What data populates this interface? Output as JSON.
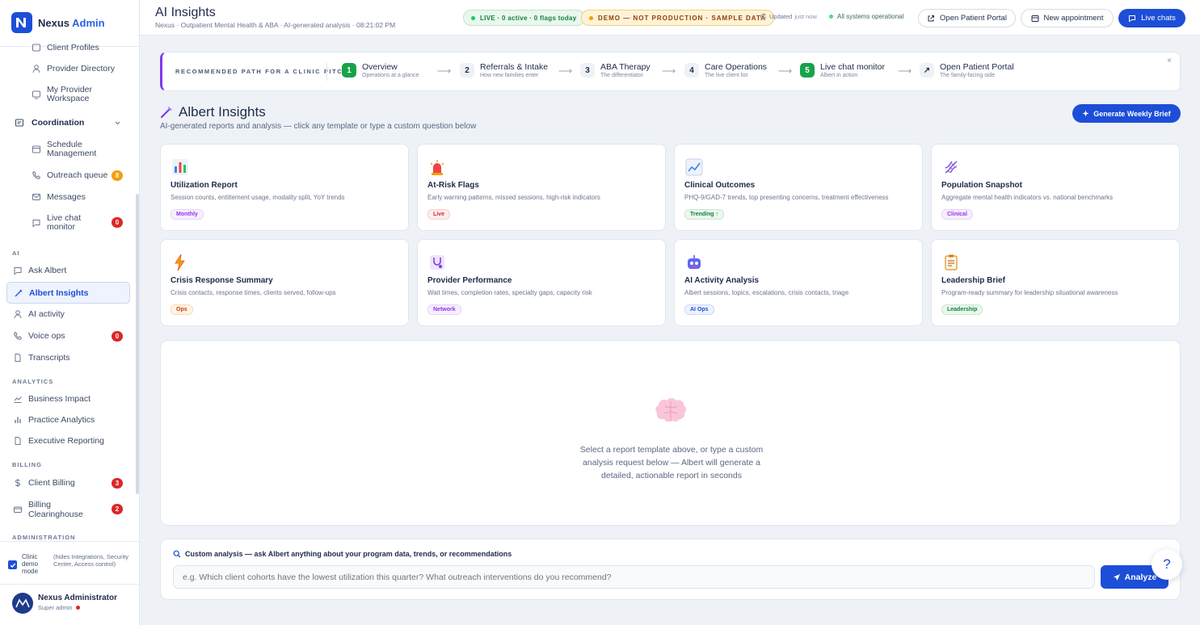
{
  "brand": {
    "name": "Nexus",
    "accent": "Admin"
  },
  "sidebar": {
    "items_top": [
      {
        "label": "Client Profiles",
        "icon": "folder-icon"
      },
      {
        "label": "Provider Directory",
        "icon": "user-icon"
      },
      {
        "label": "My Provider Workspace",
        "icon": "monitor-icon"
      }
    ],
    "coordination": {
      "label": "Coordination",
      "items": [
        {
          "label": "Schedule Management",
          "icon": "calendar-icon"
        },
        {
          "label": "Outreach queue",
          "icon": "phone-icon",
          "badge": "8"
        },
        {
          "label": "Messages",
          "icon": "mail-icon"
        },
        {
          "label": "Live chat monitor",
          "icon": "chat-icon",
          "badge": "0"
        }
      ]
    },
    "sections": {
      "ai": "AI",
      "analytics": "ANALYTICS",
      "billing": "BILLING",
      "admin": "ADMINISTRATION"
    },
    "ai_items": [
      {
        "label": "Ask Albert",
        "icon": "chat-icon"
      },
      {
        "label": "Albert Insights",
        "icon": "wand-icon"
      },
      {
        "label": "AI activity",
        "icon": "user-icon"
      },
      {
        "label": "Voice ops",
        "icon": "phone-icon",
        "badge": "0"
      },
      {
        "label": "Transcripts",
        "icon": "document-icon"
      }
    ],
    "analytics_items": [
      {
        "label": "Business Impact",
        "icon": "trend-icon"
      },
      {
        "label": "Practice Analytics",
        "icon": "bar-chart-icon"
      },
      {
        "label": "Executive Reporting",
        "icon": "document-icon"
      }
    ],
    "billing_items": [
      {
        "label": "Client Billing",
        "icon": "dollar-icon",
        "badge": "3"
      },
      {
        "label": "Billing Clearinghouse",
        "icon": "card-icon",
        "badge": "2"
      }
    ],
    "demo_mode": {
      "label": "Clinic demo mode",
      "note": "(hides Integrations, Security Center, Access control)"
    },
    "user": {
      "name": "Nexus Administrator",
      "role": "Super admin"
    }
  },
  "header": {
    "title": "AI Insights",
    "subtitle": "Nexus · Outpatient Mental Health & ABA · AI-generated analysis · 08:21:02 PM",
    "live_pill": "LIVE · 0 active · 0 flags today",
    "demo_pill": "DEMO — NOT PRODUCTION · SAMPLE DATA",
    "updated_label": "Updated",
    "updated_value": "just now",
    "systems": "All systems operational",
    "btn_portal": "Open Patient Portal",
    "btn_appt": "New appointment",
    "btn_chats": "Live chats"
  },
  "path": {
    "label": "RECOMMENDED PATH FOR A CLINIC PITCH",
    "close": "×",
    "steps": [
      {
        "num": "1",
        "title": "Overview",
        "sub": "Operations at a glance"
      },
      {
        "num": "2",
        "title": "Referrals & Intake",
        "sub": "How new families enter"
      },
      {
        "num": "3",
        "title": "ABA Therapy",
        "sub": "The differentiator"
      },
      {
        "num": "4",
        "title": "Care Operations",
        "sub": "The live client list"
      },
      {
        "num": "5",
        "title": "Live chat monitor",
        "sub": "Albert in action"
      },
      {
        "num": "↗",
        "title": "Open Patient Portal",
        "sub": "The family-facing side"
      }
    ]
  },
  "insights": {
    "title": "Albert Insights",
    "subtitle": "AI-generated reports and analysis — click any template or type a custom question below",
    "generate_btn": "Generate Weekly Brief"
  },
  "cards": [
    {
      "title": "Utilization Report",
      "desc": "Session counts, entitlement usage, modality split, YoY trends",
      "tag": "Monthly",
      "icon": "bar-chart-icon"
    },
    {
      "title": "At-Risk Flags",
      "desc": "Early warning patterns, missed sessions, high-risk indicators",
      "tag": "Live",
      "icon": "siren-icon"
    },
    {
      "title": "Clinical Outcomes",
      "desc": "PHQ-9/GAD-7 trends, top presenting concerns, treatment effectiveness",
      "tag": "Trending ↑",
      "icon": "line-chart-icon"
    },
    {
      "title": "Population Snapshot",
      "desc": "Aggregate mental health indicators vs. national benchmarks",
      "tag": "Clinical",
      "icon": "dna-icon"
    },
    {
      "title": "Crisis Response Summary",
      "desc": "Crisis contacts, response times, clients served, follow-ups",
      "tag": "Ops",
      "icon": "lightning-icon"
    },
    {
      "title": "Provider Performance",
      "desc": "Wait times, completion rates, specialty gaps, capacity risk",
      "tag": "Network",
      "icon": "stethoscope-icon"
    },
    {
      "title": "AI Activity Analysis",
      "desc": "Albert sessions, topics, escalations, crisis contacts, triage",
      "tag": "AI Ops",
      "icon": "robot-icon"
    },
    {
      "title": "Leadership Brief",
      "desc": "Program-ready summary for leadership situational awareness",
      "tag": "Leadership",
      "icon": "clipboard-icon"
    }
  ],
  "empty": {
    "text": "Select a report template above, or type a custom analysis request below — Albert will generate a detailed, actionable report in seconds"
  },
  "custom": {
    "label": "Custom analysis — ask Albert anything about your program data, trends, or recommendations",
    "placeholder": "e.g. Which client cohorts have the lowest utilization this quarter? What outreach interventions do you recommend?",
    "button": "Analyze",
    "help": "?"
  },
  "colors": {
    "primary": "#1d4ed8",
    "accent": "#7c3aed",
    "green": "#16a34a",
    "danger": "#dc2626",
    "amber": "#f59e0b"
  }
}
